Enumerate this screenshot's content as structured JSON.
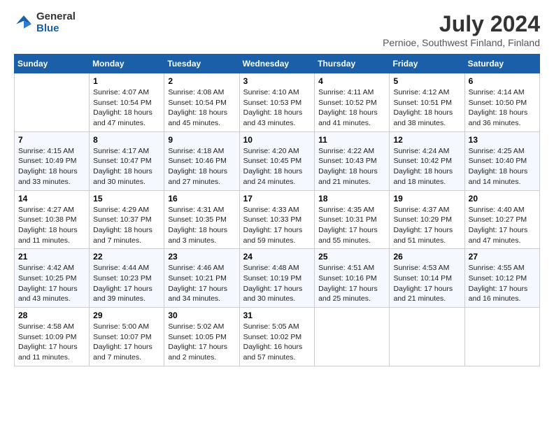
{
  "header": {
    "logo_line1": "General",
    "logo_line2": "Blue",
    "month": "July 2024",
    "location": "Pernioe, Southwest Finland, Finland"
  },
  "weekdays": [
    "Sunday",
    "Monday",
    "Tuesday",
    "Wednesday",
    "Thursday",
    "Friday",
    "Saturday"
  ],
  "weeks": [
    [
      {
        "day": "",
        "info": ""
      },
      {
        "day": "1",
        "info": "Sunrise: 4:07 AM\nSunset: 10:54 PM\nDaylight: 18 hours\nand 47 minutes."
      },
      {
        "day": "2",
        "info": "Sunrise: 4:08 AM\nSunset: 10:54 PM\nDaylight: 18 hours\nand 45 minutes."
      },
      {
        "day": "3",
        "info": "Sunrise: 4:10 AM\nSunset: 10:53 PM\nDaylight: 18 hours\nand 43 minutes."
      },
      {
        "day": "4",
        "info": "Sunrise: 4:11 AM\nSunset: 10:52 PM\nDaylight: 18 hours\nand 41 minutes."
      },
      {
        "day": "5",
        "info": "Sunrise: 4:12 AM\nSunset: 10:51 PM\nDaylight: 18 hours\nand 38 minutes."
      },
      {
        "day": "6",
        "info": "Sunrise: 4:14 AM\nSunset: 10:50 PM\nDaylight: 18 hours\nand 36 minutes."
      }
    ],
    [
      {
        "day": "7",
        "info": "Sunrise: 4:15 AM\nSunset: 10:49 PM\nDaylight: 18 hours\nand 33 minutes."
      },
      {
        "day": "8",
        "info": "Sunrise: 4:17 AM\nSunset: 10:47 PM\nDaylight: 18 hours\nand 30 minutes."
      },
      {
        "day": "9",
        "info": "Sunrise: 4:18 AM\nSunset: 10:46 PM\nDaylight: 18 hours\nand 27 minutes."
      },
      {
        "day": "10",
        "info": "Sunrise: 4:20 AM\nSunset: 10:45 PM\nDaylight: 18 hours\nand 24 minutes."
      },
      {
        "day": "11",
        "info": "Sunrise: 4:22 AM\nSunset: 10:43 PM\nDaylight: 18 hours\nand 21 minutes."
      },
      {
        "day": "12",
        "info": "Sunrise: 4:24 AM\nSunset: 10:42 PM\nDaylight: 18 hours\nand 18 minutes."
      },
      {
        "day": "13",
        "info": "Sunrise: 4:25 AM\nSunset: 10:40 PM\nDaylight: 18 hours\nand 14 minutes."
      }
    ],
    [
      {
        "day": "14",
        "info": "Sunrise: 4:27 AM\nSunset: 10:38 PM\nDaylight: 18 hours\nand 11 minutes."
      },
      {
        "day": "15",
        "info": "Sunrise: 4:29 AM\nSunset: 10:37 PM\nDaylight: 18 hours\nand 7 minutes."
      },
      {
        "day": "16",
        "info": "Sunrise: 4:31 AM\nSunset: 10:35 PM\nDaylight: 18 hours\nand 3 minutes."
      },
      {
        "day": "17",
        "info": "Sunrise: 4:33 AM\nSunset: 10:33 PM\nDaylight: 17 hours\nand 59 minutes."
      },
      {
        "day": "18",
        "info": "Sunrise: 4:35 AM\nSunset: 10:31 PM\nDaylight: 17 hours\nand 55 minutes."
      },
      {
        "day": "19",
        "info": "Sunrise: 4:37 AM\nSunset: 10:29 PM\nDaylight: 17 hours\nand 51 minutes."
      },
      {
        "day": "20",
        "info": "Sunrise: 4:40 AM\nSunset: 10:27 PM\nDaylight: 17 hours\nand 47 minutes."
      }
    ],
    [
      {
        "day": "21",
        "info": "Sunrise: 4:42 AM\nSunset: 10:25 PM\nDaylight: 17 hours\nand 43 minutes."
      },
      {
        "day": "22",
        "info": "Sunrise: 4:44 AM\nSunset: 10:23 PM\nDaylight: 17 hours\nand 39 minutes."
      },
      {
        "day": "23",
        "info": "Sunrise: 4:46 AM\nSunset: 10:21 PM\nDaylight: 17 hours\nand 34 minutes."
      },
      {
        "day": "24",
        "info": "Sunrise: 4:48 AM\nSunset: 10:19 PM\nDaylight: 17 hours\nand 30 minutes."
      },
      {
        "day": "25",
        "info": "Sunrise: 4:51 AM\nSunset: 10:16 PM\nDaylight: 17 hours\nand 25 minutes."
      },
      {
        "day": "26",
        "info": "Sunrise: 4:53 AM\nSunset: 10:14 PM\nDaylight: 17 hours\nand 21 minutes."
      },
      {
        "day": "27",
        "info": "Sunrise: 4:55 AM\nSunset: 10:12 PM\nDaylight: 17 hours\nand 16 minutes."
      }
    ],
    [
      {
        "day": "28",
        "info": "Sunrise: 4:58 AM\nSunset: 10:09 PM\nDaylight: 17 hours\nand 11 minutes."
      },
      {
        "day": "29",
        "info": "Sunrise: 5:00 AM\nSunset: 10:07 PM\nDaylight: 17 hours\nand 7 minutes."
      },
      {
        "day": "30",
        "info": "Sunrise: 5:02 AM\nSunset: 10:05 PM\nDaylight: 17 hours\nand 2 minutes."
      },
      {
        "day": "31",
        "info": "Sunrise: 5:05 AM\nSunset: 10:02 PM\nDaylight: 16 hours\nand 57 minutes."
      },
      {
        "day": "",
        "info": ""
      },
      {
        "day": "",
        "info": ""
      },
      {
        "day": "",
        "info": ""
      }
    ]
  ]
}
